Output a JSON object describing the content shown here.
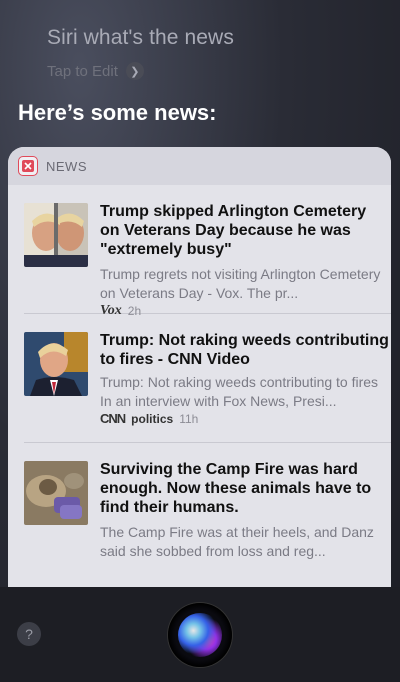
{
  "query": "Siri what's the news",
  "tap_to_edit": "Tap to Edit",
  "heading": "Here’s some news:",
  "card": {
    "app_label": "NEWS",
    "items": [
      {
        "title": "Trump skipped Arlington Cemetery on Veterans Day because he was \"extremely busy\"",
        "snippet": "Trump regrets not visiting Arlington Cemetery on Veterans Day - Vox. The pr...",
        "source": "Vox",
        "time": "2h"
      },
      {
        "title": "Trump: Not raking weeds contributing to fires - CNN Video",
        "snippet": "Trump: Not raking weeds contributing to fires In an interview with Fox News, Presi...",
        "source": "CNN",
        "section": "politics",
        "time": "11h"
      },
      {
        "title": "Surviving the Camp Fire was hard enough. Now these animals have to find their humans.",
        "snippet": "The Camp Fire was at their heels, and Danz said she sobbed from loss and reg..."
      }
    ]
  },
  "help_label": "?",
  "icons": {
    "chevron": "chevron-right-icon",
    "news_app": "news-app-icon",
    "help": "help-icon",
    "siri": "siri-icon"
  }
}
